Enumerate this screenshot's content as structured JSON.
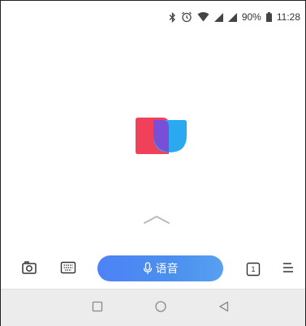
{
  "status_bar": {
    "icons": [
      "bluetooth-icon",
      "alarm-icon",
      "wifi-icon",
      "signal-icon",
      "signal-icon",
      "battery-icon"
    ],
    "battery": "90%",
    "time": "11:28"
  },
  "main": {
    "logo": "app-logo",
    "pull_hint_icon": "chevron-up-icon"
  },
  "toolbar": {
    "camera_icon": "camera-icon",
    "keyboard_icon": "keyboard-icon",
    "voice_label": "语音",
    "voice_icon": "microphone-icon",
    "tab_count": "1",
    "menu_icon": "menu-icon",
    "accent_color": "#4e82f7"
  },
  "nav_bar": {
    "icons": [
      "recents-square-icon",
      "home-circle-icon",
      "back-triangle-icon"
    ]
  },
  "colors": {
    "logo_red": "#f0405a",
    "logo_blue": "#2aa8f0",
    "logo_overlap": "#7a4fd8"
  }
}
